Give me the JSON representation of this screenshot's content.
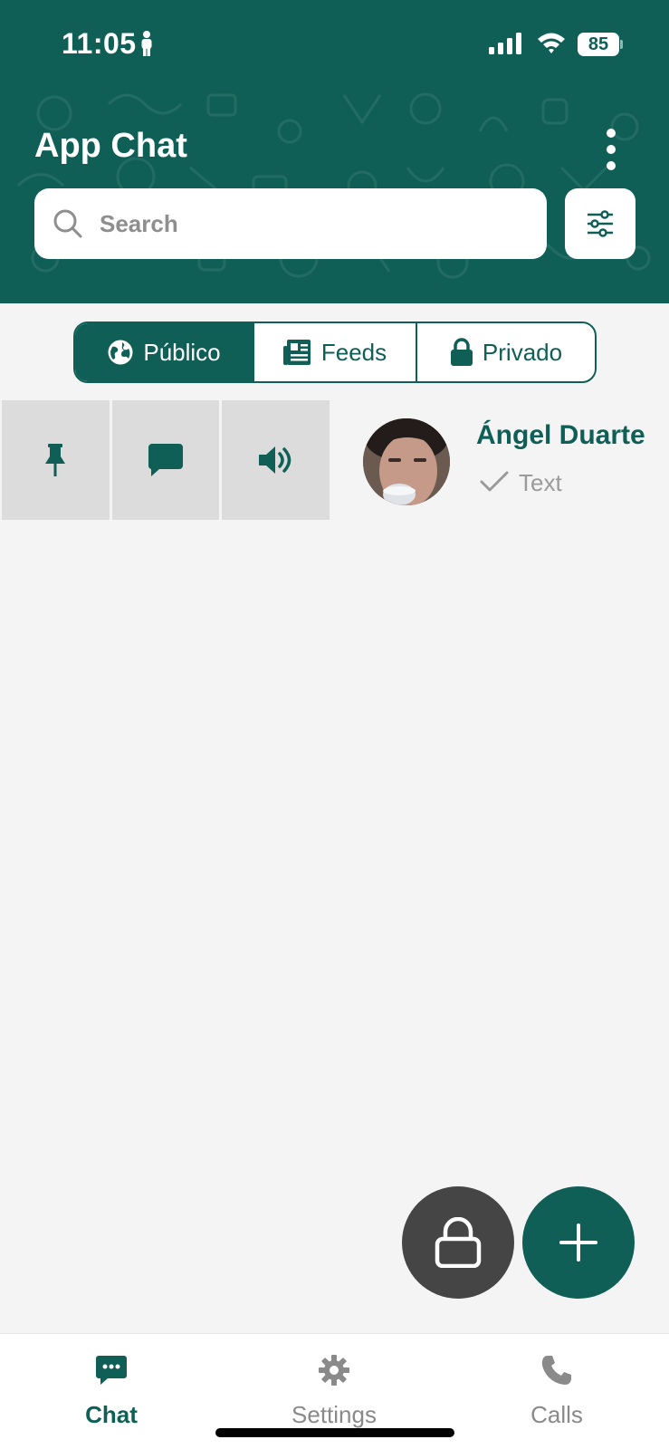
{
  "status_bar": {
    "time": "11:05",
    "battery": "85",
    "icons": [
      "person-icon",
      "cellular-signal-icon",
      "wifi-icon",
      "battery-icon"
    ]
  },
  "header": {
    "title": "App Chat",
    "menu_icon": "more-vertical-icon"
  },
  "search": {
    "placeholder": "Search",
    "value": "",
    "icon": "search-icon",
    "filter_icon": "sliders-icon"
  },
  "tabs": [
    {
      "label": "Público",
      "icon": "globe-icon",
      "active": true
    },
    {
      "label": "Feeds",
      "icon": "newspaper-icon",
      "active": false
    },
    {
      "label": "Privado",
      "icon": "lock-icon",
      "active": false
    }
  ],
  "swipe_actions": [
    {
      "icon": "pin-icon"
    },
    {
      "icon": "message-icon"
    },
    {
      "icon": "volume-icon"
    }
  ],
  "chats": [
    {
      "name": "Ángel Duarte",
      "last_message": "Text",
      "status_icon": "check-icon"
    }
  ],
  "fabs": {
    "lock_icon": "lock-icon",
    "add_icon": "plus-icon"
  },
  "bottom_nav": [
    {
      "label": "Chat",
      "icon": "chat-bubble-icon",
      "active": true
    },
    {
      "label": "Settings",
      "icon": "gear-icon",
      "active": false
    },
    {
      "label": "Calls",
      "icon": "phone-icon",
      "active": false
    }
  ],
  "colors": {
    "primary": "#0f5f56",
    "background": "#f4f4f4",
    "swipe_action_bg": "#dcdcdc",
    "lock_fab": "#454545",
    "inactive": "#8a8a8a"
  }
}
